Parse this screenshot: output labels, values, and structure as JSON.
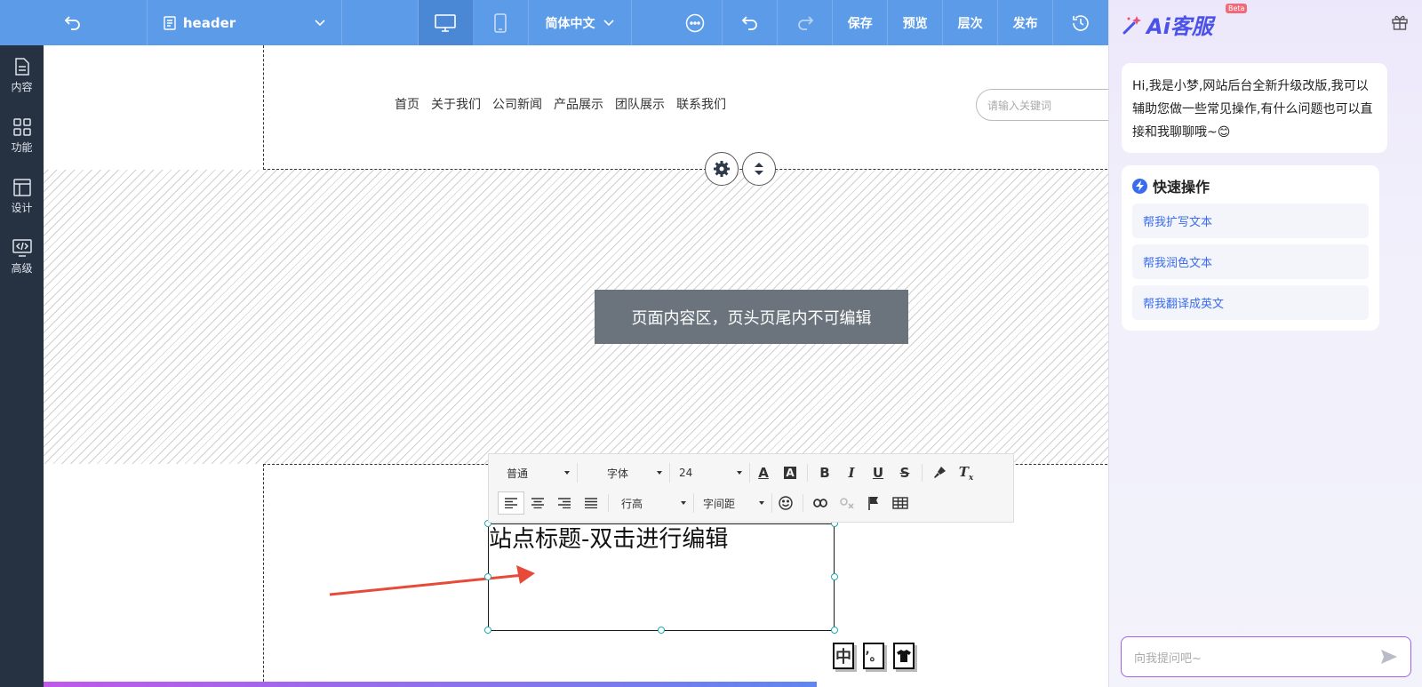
{
  "topbar": {
    "page_name": "header",
    "language": "简体中文",
    "save": "保存",
    "preview": "预览",
    "layers": "层次",
    "publish": "发布"
  },
  "leftnav": [
    {
      "label": "内容",
      "icon": "document-icon"
    },
    {
      "label": "功能",
      "icon": "grid-icon"
    },
    {
      "label": "设计",
      "icon": "layout-icon"
    },
    {
      "label": "高级",
      "icon": "code-monitor-icon"
    }
  ],
  "site": {
    "nav": [
      "首页",
      "关于我们",
      "公司新闻",
      "产品展示",
      "团队展示",
      "联系我们"
    ],
    "search_placeholder": "请输入关键词",
    "notice": "页面内容区，页头页尾内不可编辑",
    "title_text": "站点标题-双击进行编辑"
  },
  "editor": {
    "paragraph": "普通",
    "font": "字体",
    "size": "24",
    "line_height": "行高",
    "letter_spacing": "字间距"
  },
  "float_icons": [
    "中",
    "’。",
    "👕"
  ],
  "ai": {
    "logo": "Ai客服",
    "beta": "Beta",
    "greeting": "Hi,我是小梦,网站后台全新升级改版,我可以辅助您做一些常见操作,有什么问题也可以直接和我聊聊哦~😊",
    "quick_title": "快速操作",
    "quick_items": [
      "帮我扩写文本",
      "帮我润色文本",
      "帮我翻译成英文"
    ],
    "ask_placeholder": "向我提问吧~"
  },
  "colors": {
    "topbar": "#5b9be8",
    "leftnav": "#263142",
    "accent": "#3a6cf0"
  }
}
